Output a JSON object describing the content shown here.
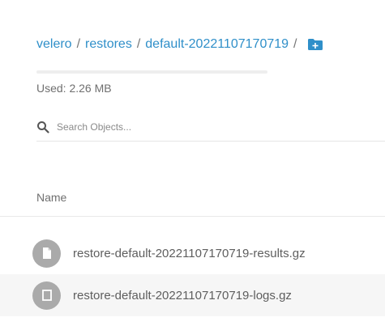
{
  "breadcrumb": {
    "items": [
      "velero",
      "restores",
      "default-20221107170719"
    ],
    "separator": "/",
    "add_icon": "folder-plus-icon"
  },
  "usage": {
    "label": "Used: 2.26 MB",
    "fraction": 0.0
  },
  "search": {
    "placeholder": "Search Objects..."
  },
  "table": {
    "columns": [
      "Name"
    ],
    "rows": [
      {
        "name": "restore-default-20221107170719-results.gz",
        "icon": "file-icon"
      },
      {
        "name": "restore-default-20221107170719-logs.gz",
        "icon": "file-icon"
      }
    ]
  },
  "colors": {
    "accent": "#2f8fc9",
    "icon_bg": "#aaaaaa",
    "row_alt": "#f6f6f6"
  }
}
